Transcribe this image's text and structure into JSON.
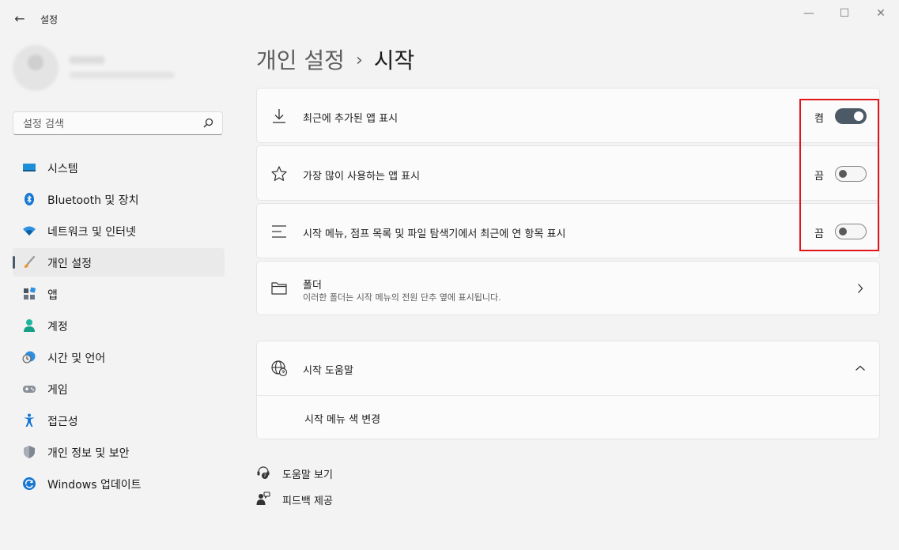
{
  "window": {
    "title": "설정",
    "back_glyph": "←",
    "minimize_glyph": "—",
    "maximize_glyph": "☐",
    "close_glyph": "✕"
  },
  "search": {
    "placeholder": "설정 검색"
  },
  "sidebar": {
    "items": [
      {
        "label": "시스템",
        "icon": "system-icon"
      },
      {
        "label": "Bluetooth 및 장치",
        "icon": "bluetooth-icon"
      },
      {
        "label": "네트워크 및 인터넷",
        "icon": "wifi-icon"
      },
      {
        "label": "개인 설정",
        "icon": "brush-icon",
        "active": true
      },
      {
        "label": "앱",
        "icon": "apps-icon"
      },
      {
        "label": "계정",
        "icon": "account-icon"
      },
      {
        "label": "시간 및 언어",
        "icon": "time-language-icon"
      },
      {
        "label": "게임",
        "icon": "gamepad-icon"
      },
      {
        "label": "접근성",
        "icon": "accessibility-icon"
      },
      {
        "label": "개인 정보 및 보안",
        "icon": "shield-icon"
      },
      {
        "label": "Windows 업데이트",
        "icon": "update-icon"
      }
    ]
  },
  "breadcrumb": {
    "parent": "개인 설정",
    "separator": "›",
    "current": "시작"
  },
  "settings": {
    "recent_apps": {
      "label": "최근에 추가된 앱 표시",
      "state": "켬",
      "on": true
    },
    "most_used": {
      "label": "가장 많이 사용하는 앱 표시",
      "state": "끔",
      "on": false
    },
    "recent_items": {
      "label": "시작 메뉴, 점프 목록 및 파일 탐색기에서 최근에 연 항목 표시",
      "state": "끔",
      "on": false
    },
    "folders": {
      "label": "폴더",
      "description": "이러한 폴더는 시작 메뉴의 전원 단추 옆에 표시됩니다."
    }
  },
  "help_section": {
    "title": "시작 도움말",
    "link": "시작 메뉴 색 변경"
  },
  "footer": {
    "get_help": "도움말 보기",
    "feedback": "피드백 제공"
  },
  "colors": {
    "accent": "#4c5a68",
    "highlight": "#e2141b",
    "background": "#f3f3f3"
  }
}
